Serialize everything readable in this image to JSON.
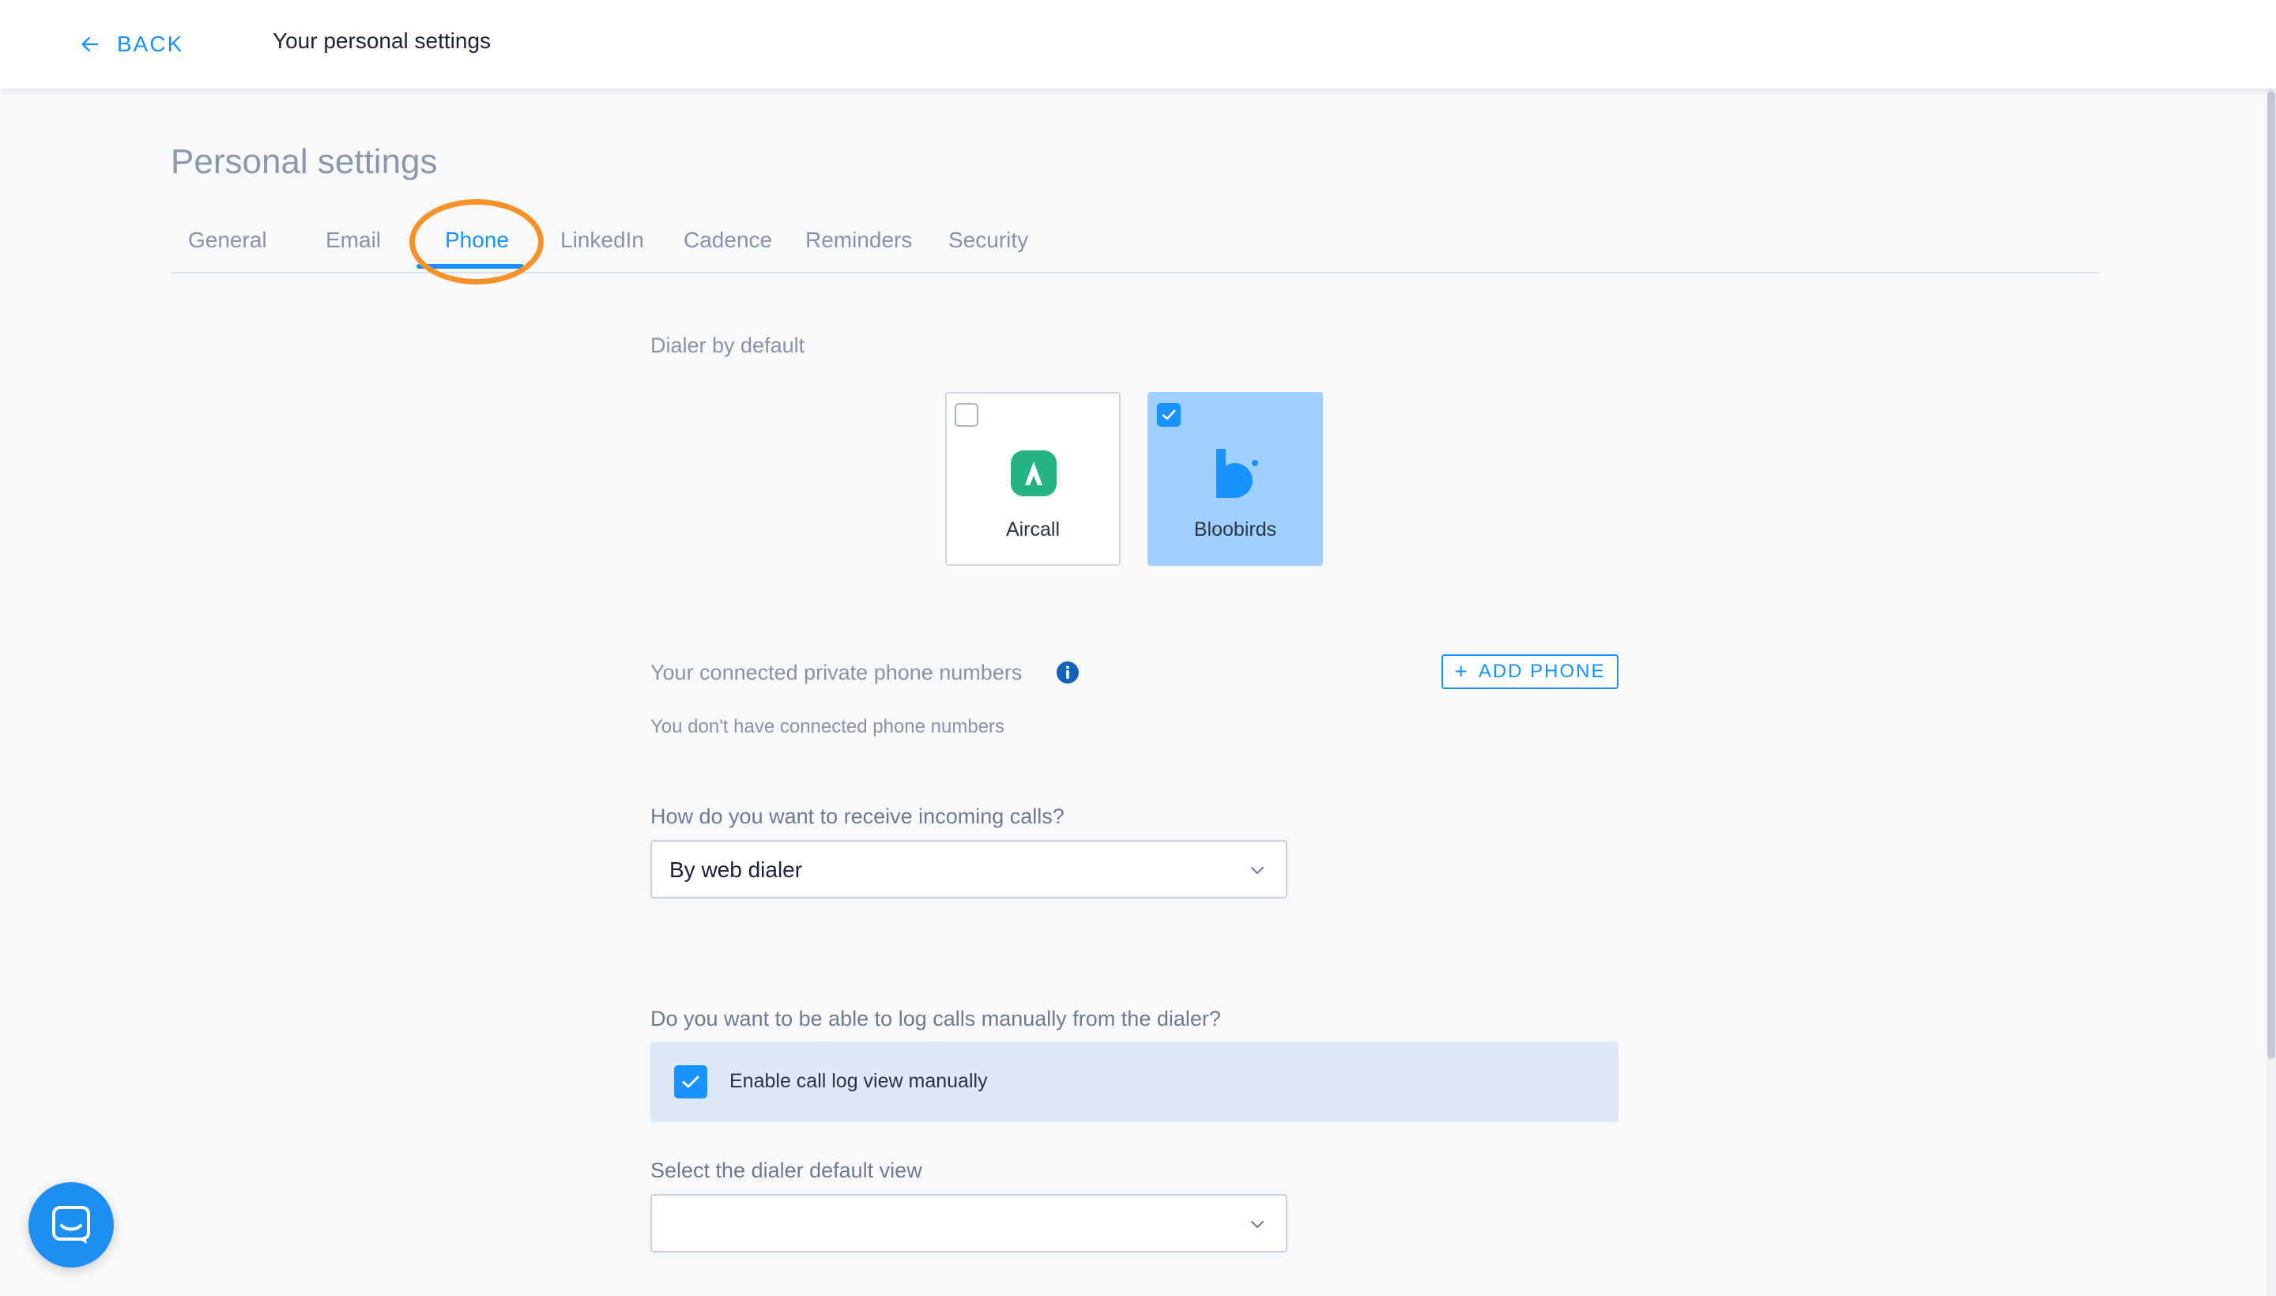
{
  "header": {
    "back_label": "BACK",
    "title": "Your personal settings"
  },
  "page": {
    "title": "Personal settings"
  },
  "tabs": [
    {
      "label": "General",
      "active": false
    },
    {
      "label": "Email",
      "active": false
    },
    {
      "label": "Phone",
      "active": true
    },
    {
      "label": "LinkedIn",
      "active": false
    },
    {
      "label": "Cadence",
      "active": false
    },
    {
      "label": "Reminders",
      "active": false
    },
    {
      "label": "Security",
      "active": false
    }
  ],
  "dialer": {
    "label": "Dialer by default",
    "options": [
      {
        "name": "Aircall",
        "selected": false,
        "icon": "aircall-logo-icon"
      },
      {
        "name": "Bloobirds",
        "selected": true,
        "icon": "bloobirds-logo-icon"
      }
    ]
  },
  "phones": {
    "label": "Your connected private phone numbers",
    "add_label": "ADD PHONE",
    "empty_text": "You don't have connected phone numbers"
  },
  "incoming": {
    "label": "How do you want to receive incoming calls?",
    "selected": "By web dialer"
  },
  "log_calls": {
    "label": "Do you want to be able to log calls manually from the dialer?",
    "checkbox_label": "Enable call log view manually",
    "checked": true
  },
  "default_view": {
    "label": "Select the dialer default view",
    "selected": ""
  },
  "colors": {
    "accent": "#1991ff",
    "highlight": "#f7912a",
    "selected_card": "#9fd0fe",
    "aircall_green": "#26b383"
  }
}
